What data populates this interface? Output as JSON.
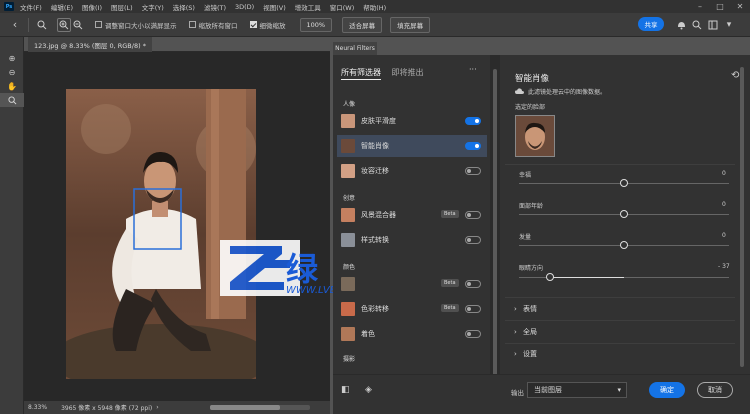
{
  "menubar": {
    "app_badge": "Ps",
    "items": [
      "文件(F)",
      "编辑(E)",
      "图像(I)",
      "图层(L)",
      "文字(Y)",
      "选择(S)",
      "滤镜(T)",
      "3D(D)",
      "视图(V)",
      "增效工具",
      "窗口(W)",
      "帮助(H)"
    ]
  },
  "options": {
    "checkbox1": "调整窗口大小以满屏显示",
    "checkbox2": "缩放所有窗口",
    "checkbox3": "细微缩放",
    "zoom": "100%",
    "fit_screen": "适合屏幕",
    "fill_screen": "填充屏幕",
    "share": "共享"
  },
  "document": {
    "tab": "123.jpg @ 8.33% (图层 0, RGB/8) *",
    "zoom": "8.33%",
    "size": "3965 像素 x 5948 像素 (72 ppi)"
  },
  "panel_tab": "Neural Filters",
  "left_panel": {
    "tab_all": "所有筛选器",
    "tab_coming": "即将推出",
    "menu": "···",
    "sections": [
      "人像",
      "创意",
      "颜色",
      "摄影"
    ],
    "filters": [
      {
        "label": "皮肤平滑度",
        "on": true
      },
      {
        "label": "智能肖像",
        "on": true,
        "selected": true
      },
      {
        "label": "妆容迁移",
        "on": false
      },
      {
        "label": "风景混合器",
        "on": false,
        "beta": "Beta"
      },
      {
        "label": "样式转换",
        "on": false
      },
      {
        "label": "",
        "on": false,
        "beta": "Beta"
      },
      {
        "label": "色彩转移",
        "on": false,
        "beta": "Beta"
      },
      {
        "label": "着色",
        "on": false
      }
    ]
  },
  "right_panel": {
    "title": "智能肖像",
    "cloud_note": "此滤镜处理云中的图像数据。",
    "selected_face": "选定的脸部",
    "sliders": [
      {
        "label": "幸福",
        "value": "0",
        "pos": 0.5
      },
      {
        "label": "面部年龄",
        "value": "0",
        "pos": 0.5
      },
      {
        "label": "发量",
        "value": "0",
        "pos": 0.5
      },
      {
        "label": "眼睛方向",
        "value": "- 37",
        "pos": 0.15
      }
    ],
    "accordions": [
      "表情",
      "全局",
      "设置"
    ]
  },
  "footer": {
    "output_label": "输出",
    "output_value": "当前图层",
    "ok": "确定",
    "cancel": "取消"
  },
  "watermark": {
    "cn": "绿 部 落",
    "url": "WWW.LVBULUO.COM"
  },
  "colors": {
    "accent": "#1473e6",
    "watermark_blue": "#1a5bd6"
  }
}
